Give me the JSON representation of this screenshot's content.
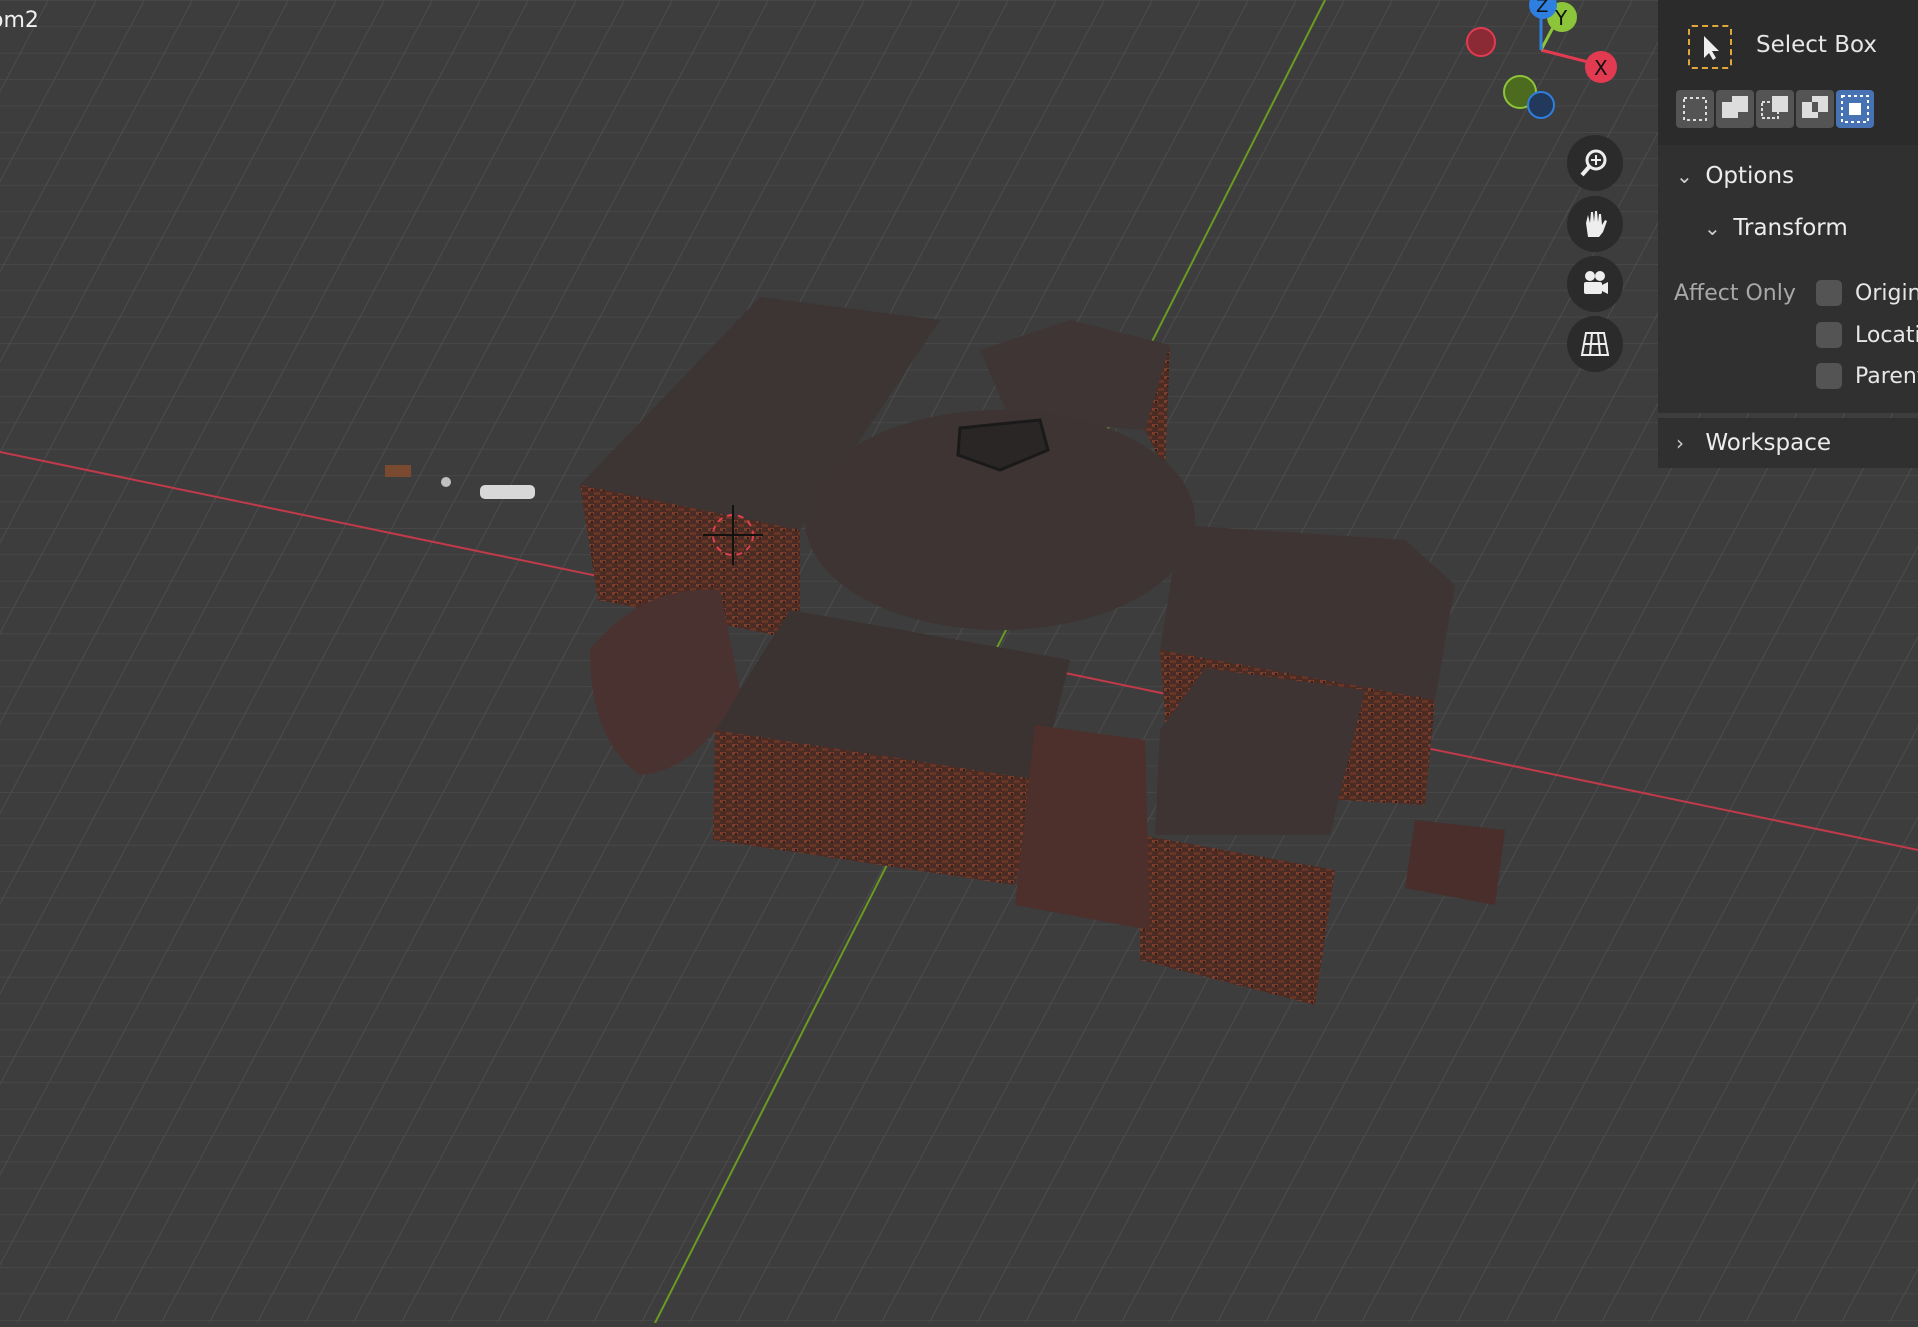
{
  "viewport": {
    "title": "om2",
    "colors": {
      "grid_bg": "#3d3d3d",
      "x_axis": "#c23a4a",
      "y_axis": "#6a9a22"
    }
  },
  "gizmo": {
    "x_label": "X",
    "y_label": "Y",
    "z_label": "Z",
    "colors": {
      "x": "#e23b51",
      "y": "#8cc43a",
      "z": "#2f7fe0"
    }
  },
  "nav_buttons": [
    {
      "name": "zoom-icon"
    },
    {
      "name": "hand-pan-icon"
    },
    {
      "name": "camera-icon"
    },
    {
      "name": "perspective-grid-icon"
    }
  ],
  "tool_settings": {
    "tool_name": "Select Box",
    "modes": [
      "set",
      "extend",
      "subtract",
      "difference",
      "intersect"
    ],
    "active_mode": "intersect",
    "accent": "#4772b3"
  },
  "options": {
    "label": "Options",
    "transform": {
      "label": "Transform",
      "affect_only_label": "Affect Only",
      "checkboxes": [
        {
          "label": "Origin",
          "checked": false
        },
        {
          "label": "Locations",
          "checked": false
        },
        {
          "label": "Parents",
          "checked": false
        }
      ]
    }
  },
  "workspace": {
    "label": "Workspace"
  }
}
